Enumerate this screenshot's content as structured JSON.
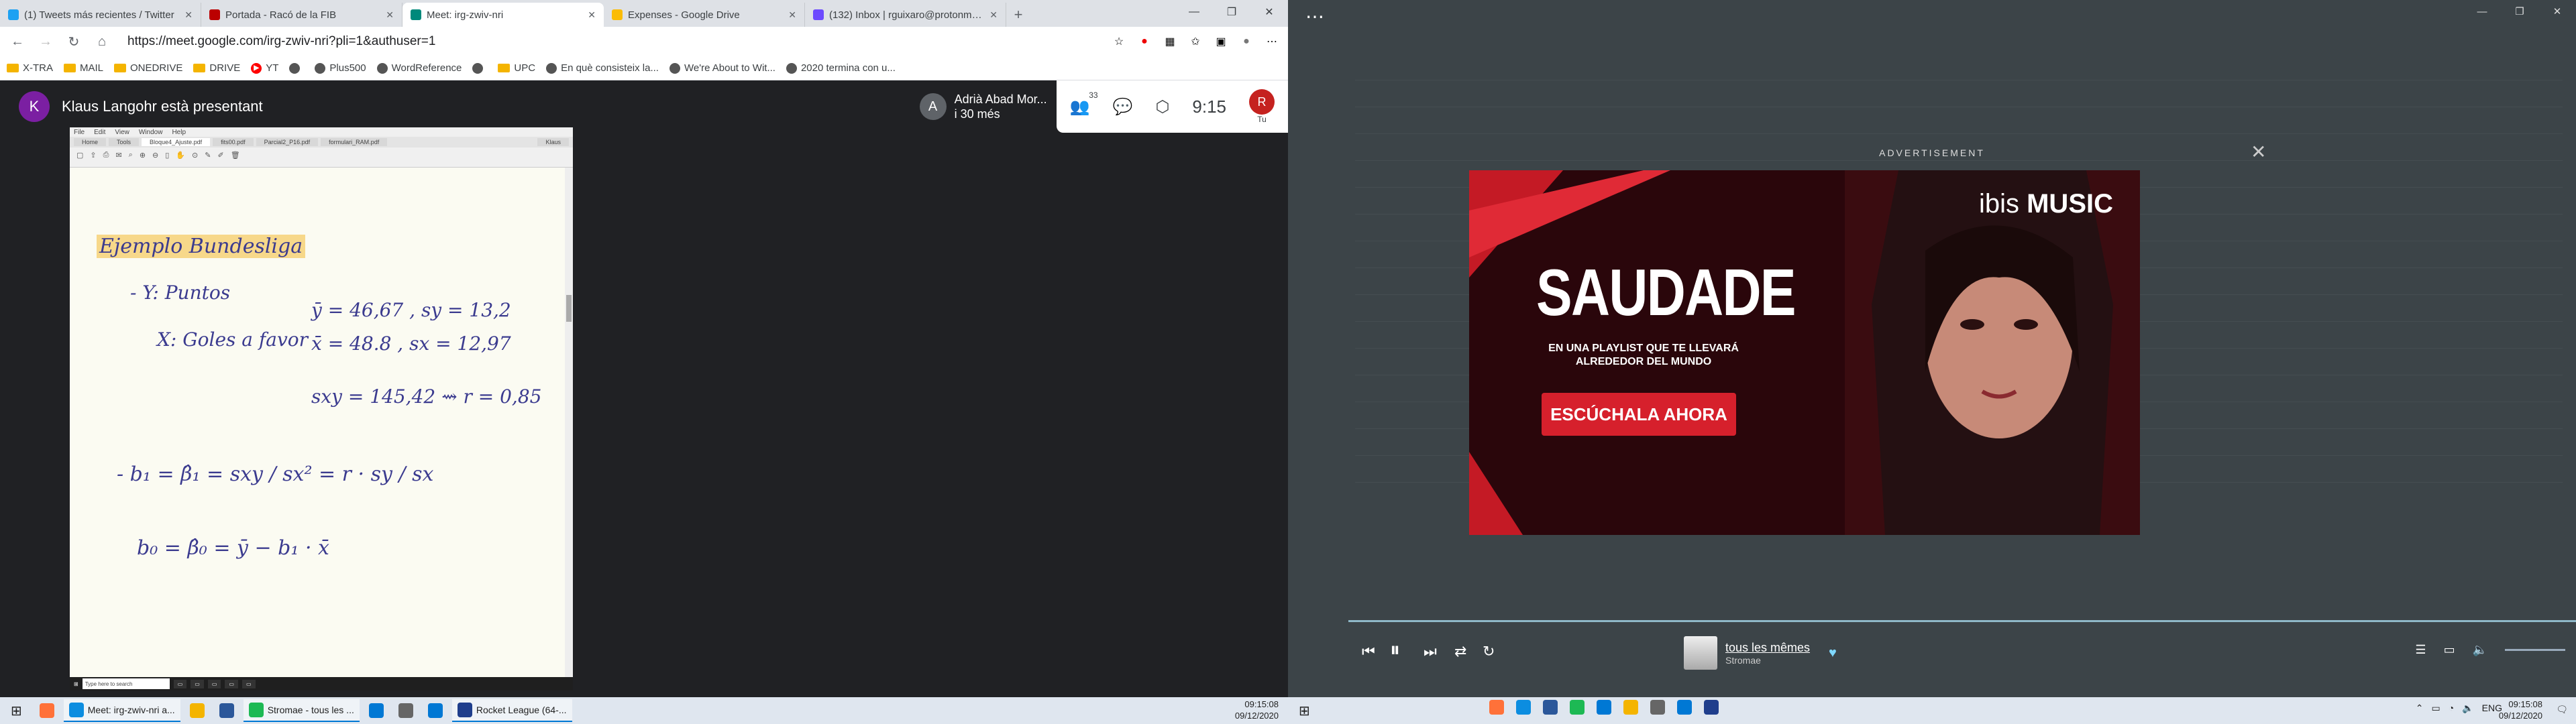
{
  "browser": {
    "tabs": [
      {
        "title": "(1) Tweets más recientes / Twitter",
        "fav_color": "#1da1f2",
        "icon": "bird-icon"
      },
      {
        "title": "Portada - Racó de la FIB",
        "fav_color": "#b00",
        "icon": "fib-icon"
      },
      {
        "title": "Meet: irg-zwiv-nri",
        "fav_color": "#00897b",
        "icon": "meet-icon",
        "active": true
      },
      {
        "title": "Expenses - Google Drive",
        "fav_color": "#fbbc04",
        "icon": "drive-icon"
      },
      {
        "title": "(132) Inbox | rguixaro@protonmail.com",
        "fav_color": "#6d4aff",
        "icon": "protonmail-icon"
      }
    ],
    "url": "https://meet.google.com/irg-zwiv-nri?pli=1&authuser=1",
    "bookmarks": [
      {
        "label": "X-TRA",
        "kind": "folder"
      },
      {
        "label": "MAIL",
        "kind": "folder"
      },
      {
        "label": "ONEDRIVE",
        "kind": "folder"
      },
      {
        "label": "DRIVE",
        "kind": "folder"
      },
      {
        "label": "YT",
        "kind": "yt"
      },
      {
        "label": "",
        "kind": "icon"
      },
      {
        "label": "Plus500",
        "kind": "icon"
      },
      {
        "label": "WordReference",
        "kind": "icon"
      },
      {
        "label": "",
        "kind": "icon"
      },
      {
        "label": "UPC",
        "kind": "folder"
      },
      {
        "label": "En què consisteix la...",
        "kind": "icon"
      },
      {
        "label": "We're About to Wit...",
        "kind": "icon"
      },
      {
        "label": "2020 termina con u...",
        "kind": "icon"
      }
    ]
  },
  "meet": {
    "presenter_initial": "K",
    "presenting_text": "Klaus Langohr està presentant",
    "speaker_initial": "A",
    "speaker_name": "Adrià Abad Mor...",
    "speaker_sub": "i 30 més",
    "participants_count": "33",
    "time": "9:15",
    "user_initial": "R",
    "user_label": "Tu"
  },
  "presentation": {
    "tabs": [
      "Bloque4_Ajuste.pdf",
      "fits00.pdf",
      "Parcial2_P16.pdf",
      "formulari_RAM.pdf"
    ],
    "heading": "Ejemplo Bundesliga",
    "y_label": "- Y: Puntos",
    "x_label": "X: Goles a favor",
    "y_stats": "ȳ = 46,67 ,  sy = 13,2",
    "x_stats": "x̄ = 48.8 ,   sx = 12,97",
    "cov": "sxy = 145,42  ⇝  r = 0,85",
    "b1": "- b₁ = β̂₁ = sxy / sx² = r · sy / sx",
    "b0": "b₀ = β̂₀ = ȳ − b₁ · x̄",
    "search_placeholder": "Type here to search",
    "user": "Klaus"
  },
  "taskbar_left": {
    "items": [
      {
        "label": "",
        "icon": "firefox-icon",
        "color": "#ff7139"
      },
      {
        "label": "Meet: irg-zwiv-nri a...",
        "icon": "edge-icon",
        "color": "#0c8de0",
        "open": true
      },
      {
        "label": "",
        "icon": "folder-icon",
        "color": "#f4b400"
      },
      {
        "label": "",
        "icon": "word-icon",
        "color": "#2b579a"
      },
      {
        "label": "Stromae - tous les ...",
        "icon": "spotify-icon",
        "color": "#1db954",
        "open": true
      },
      {
        "label": "",
        "icon": "app-icon",
        "color": "#0078d4"
      },
      {
        "label": "",
        "icon": "gear-icon",
        "color": "#666"
      },
      {
        "label": "",
        "icon": "vscode-icon",
        "color": "#0078d4"
      },
      {
        "label": "Rocket League (64-...",
        "icon": "rocket-league-icon",
        "color": "#1f3e8c",
        "open": true
      }
    ],
    "time": "09:15:08",
    "date": "09/12/2020"
  },
  "spotify": {
    "ad_label": "ADVERTISEMENT",
    "ad_brand_prefix": "ibis",
    "ad_brand": "MUSIC",
    "ad_title": "SAUDADE",
    "ad_subtitle": "EN UNA PLAYLIST QUE TE LLEVARÁ ALREDEDOR DEL MUNDO",
    "ad_button": "ESCÚCHALA AHORA",
    "track_name": "tous les mêmes",
    "artist": "Stromae"
  },
  "taskbar_right": {
    "lang": "ENG",
    "time": "09:15:08",
    "date": "09/12/2020"
  }
}
